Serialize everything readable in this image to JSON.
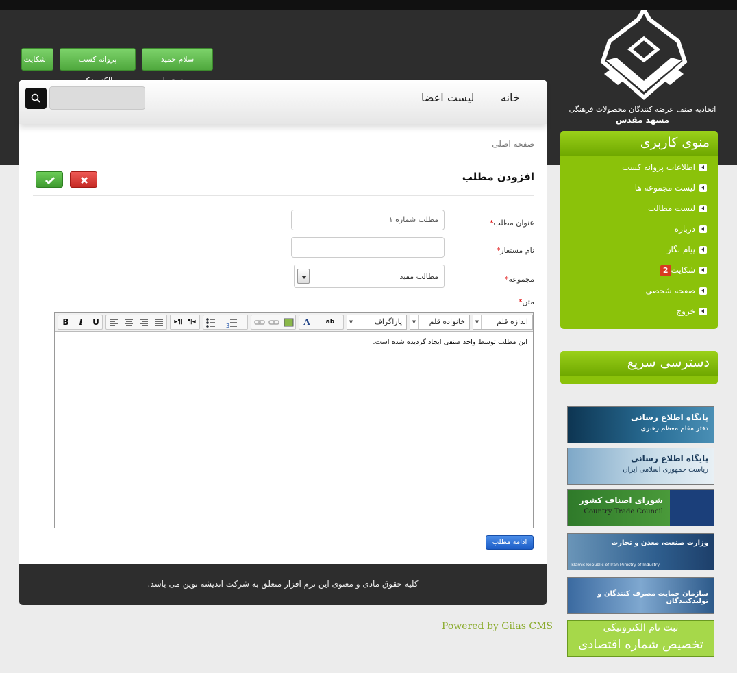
{
  "top_buttons": {
    "complaint": "شکایت",
    "license": "پروانه کسب الکترونیک",
    "greeting": "سلام حمید ممدوحی!"
  },
  "logo": {
    "line1": "اتحادیه صنف عرضه کنندگان محصولات فرهنگی",
    "line2": "مشهد مقدس"
  },
  "nav": {
    "home": "خانه",
    "members": "لیست اعضا",
    "search_placeholder": ""
  },
  "breadcrumb": "صفحه اصلی",
  "form": {
    "title": "افزودن مطلب",
    "title_label": "عنوان مطلب",
    "title_value": "مطلب شماره ۱",
    "alias_label": "نام مستعار",
    "alias_value": "",
    "category_label": "مجموعه",
    "category_value": "مطالب مفید",
    "text_label": "متن",
    "required_mark": "*",
    "continue_button": "ادامه مطلب"
  },
  "editor": {
    "font_size": "اندازه قلم",
    "font_family": "خانواده قلم",
    "paragraph": "پاراگراف",
    "body": "این مطلب توسط واحد صنفی ایجاد گردیده شده است.",
    "bold": "B",
    "italic": "I",
    "underline": "U"
  },
  "footer": {
    "copyright": "کلیه حقوق مادی و معنوی این نرم افزار متعلق به شرکت اندیشه نوین می باشد.",
    "powered": "Powered by Gilas CMS"
  },
  "user_menu": {
    "title": "منوی کاربری",
    "items": [
      {
        "label": "اطلاعات پروانه کسب"
      },
      {
        "label": "لیست مجموعه ها"
      },
      {
        "label": "لیست مطالب"
      },
      {
        "label": "درباره"
      },
      {
        "label": "پیام نگار"
      },
      {
        "label": "شکایت",
        "badge": "2"
      },
      {
        "label": "صفحه شخصی"
      },
      {
        "label": "خروج"
      }
    ]
  },
  "quick_access": {
    "title": "دسترسی سریع"
  },
  "banners": [
    {
      "title": "پایگاه اطلاع رسانی",
      "sub": "دفتر مقام معظم رهبری"
    },
    {
      "title": "پایگاه اطلاع رسانی",
      "sub": "ریاست جمهوری اسلامی ایران"
    },
    {
      "title": "شورای اصناف کشور",
      "sub": "Country Trade Council"
    },
    {
      "title": "وزارت صنعت، معدن و تجارت",
      "sub": "Islamic Republic of Iran Ministry of Industry"
    },
    {
      "title": "سازمان حمایت مصرف کنندگان و تولیدکنندگان",
      "sub": ""
    },
    {
      "title": "ثبت نام الکترونیکی",
      "sub": "تخصیص شماره اقتصادی"
    }
  ],
  "colors": {
    "accent_green": "#8bc20a",
    "dark": "#2d2d2d",
    "ok_green": "#4fa83d",
    "cancel_red": "#c52a25"
  }
}
